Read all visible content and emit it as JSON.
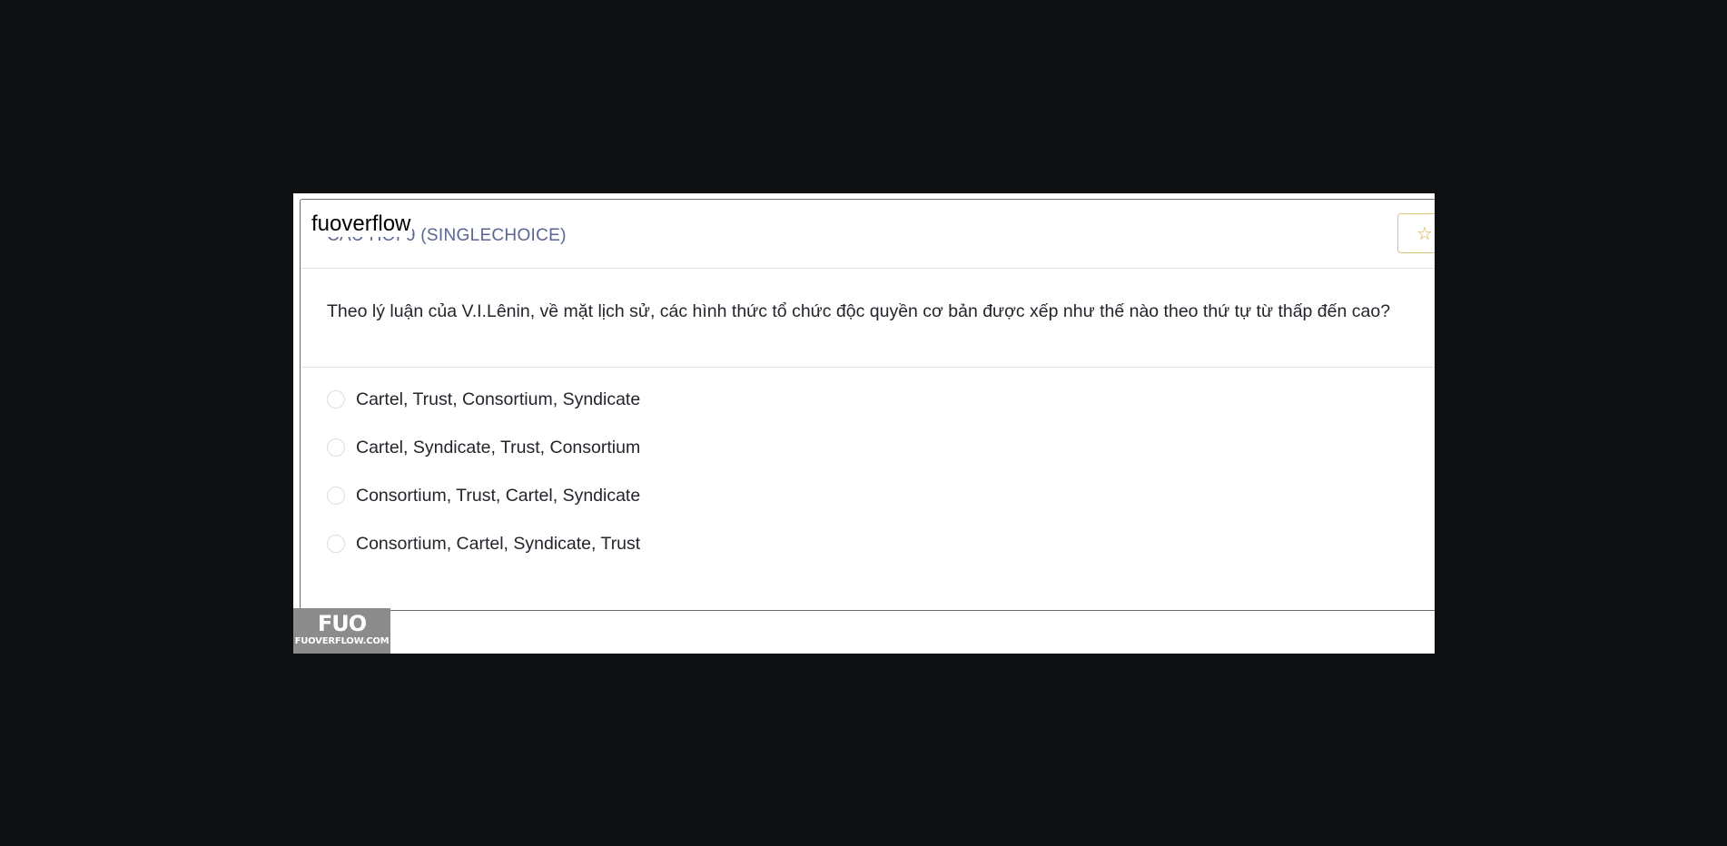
{
  "header": {
    "section_title": "CÂU HỎI 9 (SINGLECHOICE)",
    "watermark_text": "fuoverflow",
    "favorite_icon": "star-icon"
  },
  "question": {
    "text": "Theo lý luận của V.I.Lênin, về mặt lịch sử, các hình thức tổ chức độc quyền cơ bản được xếp như thế nào theo thứ tự từ thấp đến cao?"
  },
  "options": [
    {
      "label": "Cartel, Trust, Consortium, Syndicate",
      "selected": false
    },
    {
      "label": "Cartel, Syndicate, Trust, Consortium",
      "selected": false
    },
    {
      "label": "Consortium, Trust, Cartel, Syndicate",
      "selected": false
    },
    {
      "label": "Consortium, Cartel, Syndicate, Trust",
      "selected": false
    }
  ],
  "logo": {
    "mark": "FUO",
    "url": "FUOVERFLOW.COM"
  },
  "colors": {
    "background": "#0f1011",
    "title": "#5a6593",
    "star": "#d9a93a",
    "logo_bg": "#8c8c8c"
  }
}
